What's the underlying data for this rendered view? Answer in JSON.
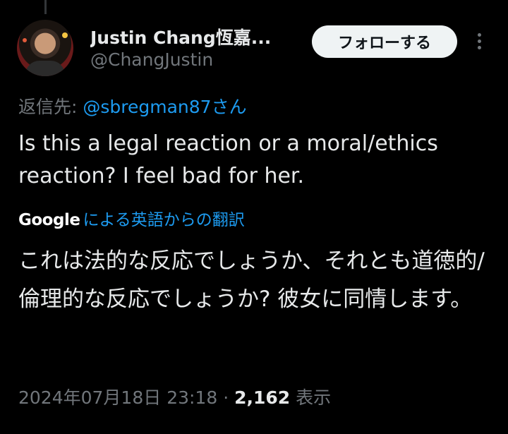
{
  "author": {
    "display_name": "Justin Chang恆嘉...",
    "handle": "@ChangJustin"
  },
  "follow_button_label": "フォローする",
  "reply": {
    "prefix": "返信先: ",
    "mention": "@sbregman87",
    "suffix": "さん"
  },
  "tweet_text": "Is this a legal reaction or a moral/ethics reaction? I feel bad for her.",
  "translation": {
    "provider": "Google",
    "label": "による英語からの翻訳",
    "text": "これは法的な反応でしょうか、それとも道徳的/倫理的な反応でしょうか? 彼女に同情します。"
  },
  "meta": {
    "timestamp": "2024年07月18日 23:18",
    "separator": " · ",
    "views_count": "2,162",
    "views_label": " 表示"
  },
  "icons": {
    "more": "more-vertical-icon",
    "avatar": "profile-photo"
  }
}
